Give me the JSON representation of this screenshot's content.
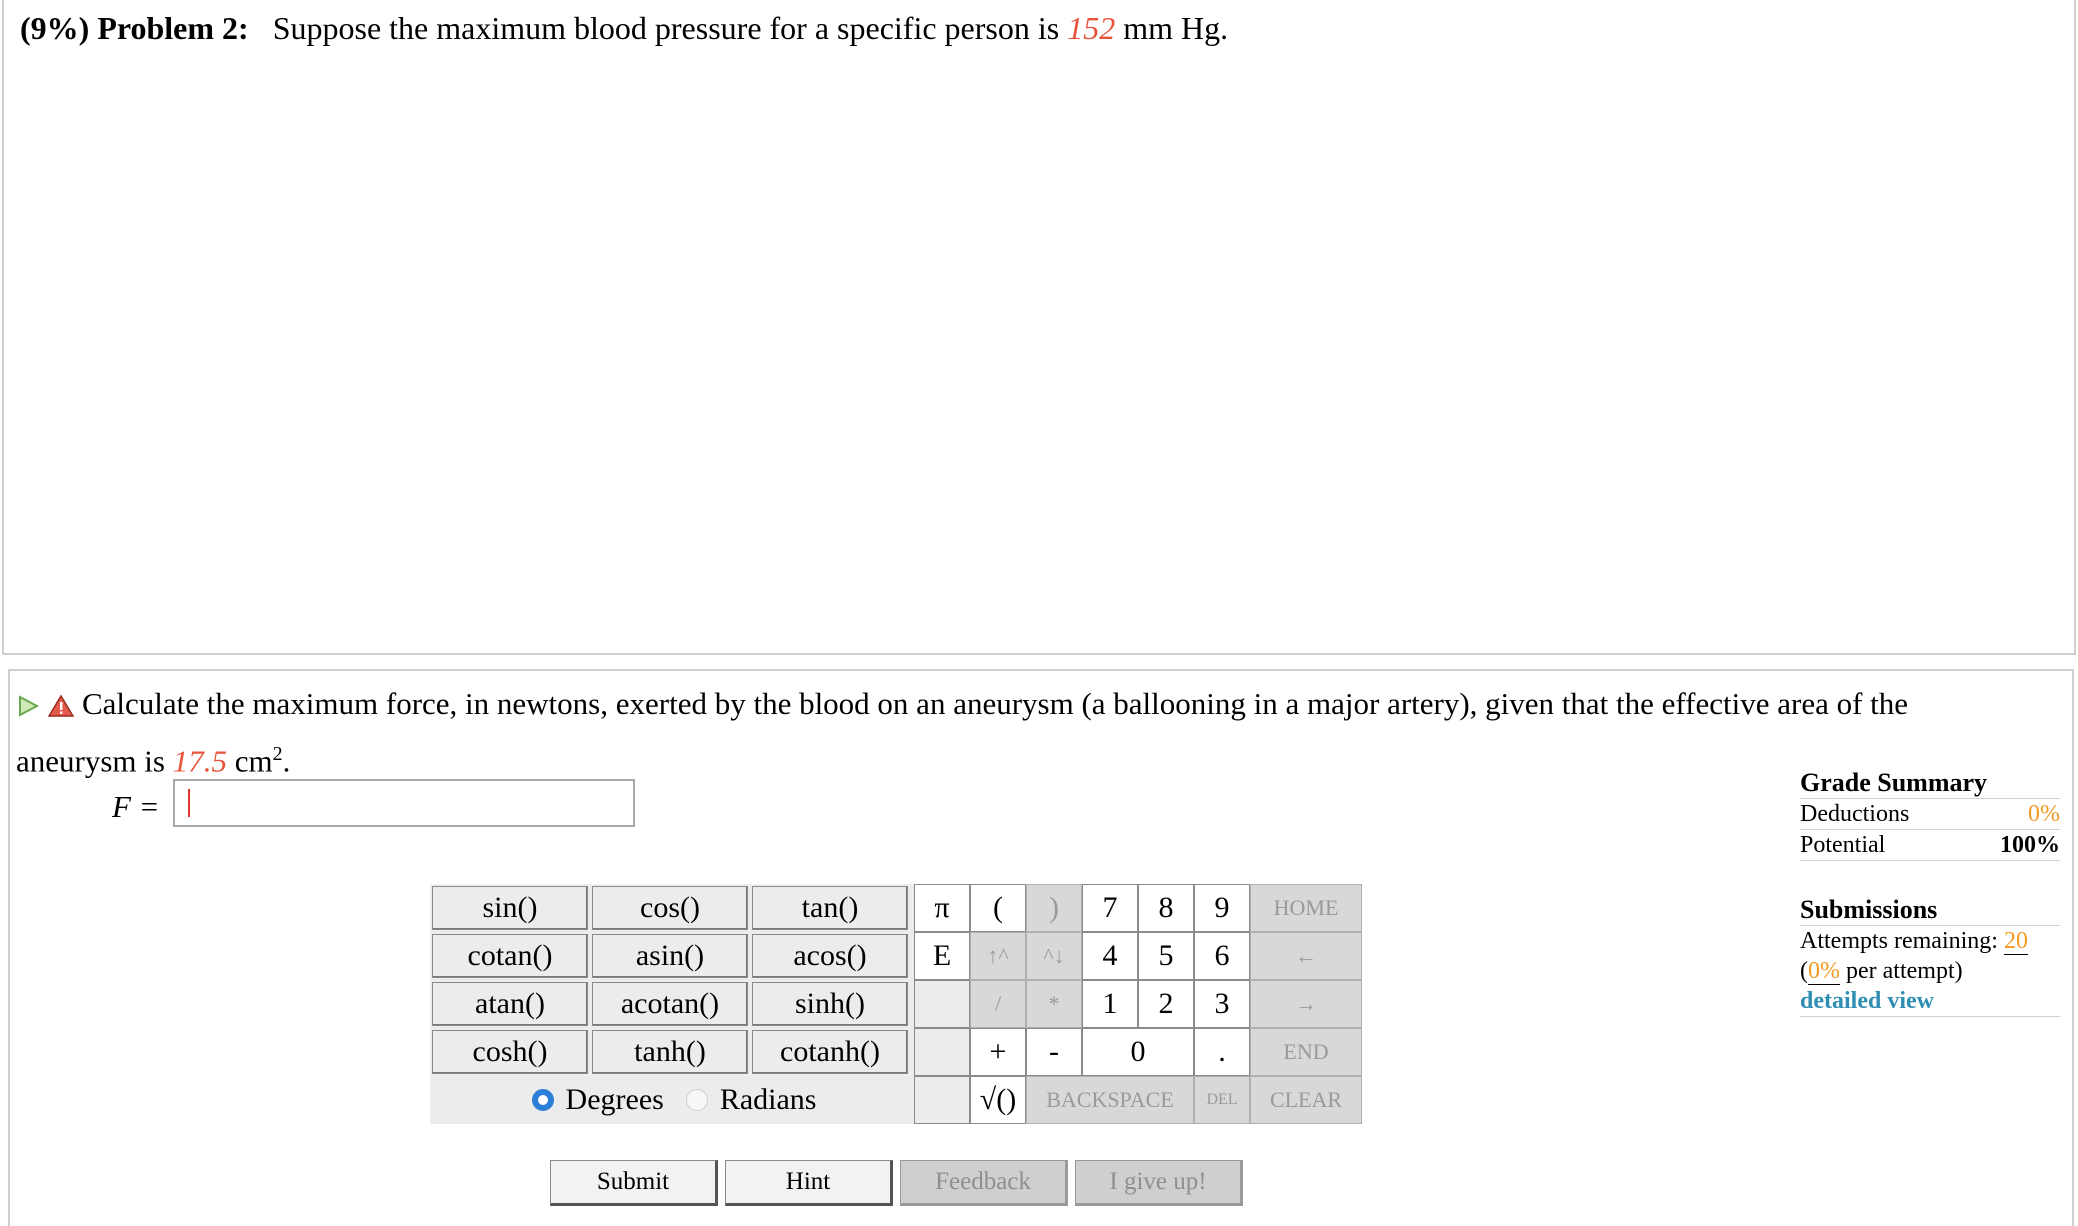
{
  "problem": {
    "percent": "(9%)",
    "name": "Problem 2:",
    "text_before": "Suppose the maximum blood pressure for a specific person is",
    "value": "152",
    "unit": "mm Hg."
  },
  "part": {
    "text_before": "Calculate the maximum force, in newtons, exerted by the blood on an aneurysm (a ballooning in a major artery), given that the effective area of the aneurysm is",
    "value": "17.5",
    "unit": "cm",
    "unit_exp": "2",
    "unit_after": ".",
    "answer_label": "F =",
    "answer_value": ""
  },
  "keypad": {
    "functions": [
      "sin()",
      "cos()",
      "tan()",
      "cotan()",
      "asin()",
      "acos()",
      "atan()",
      "acotan()",
      "sinh()",
      "cosh()",
      "tanh()",
      "cotanh()"
    ],
    "degrees": "Degrees",
    "radians": "Radians",
    "pi": "π",
    "open_paren": "(",
    "close_paren": ")",
    "e": "E",
    "up_caret": "↑^",
    "down_caret": "^↓",
    "slash": "/",
    "star": "*",
    "plus": "+",
    "minus": "-",
    "sqrt": "√()",
    "digits": [
      "7",
      "8",
      "9",
      "4",
      "5",
      "6",
      "1",
      "2",
      "3",
      "0",
      "."
    ],
    "home": "HOME",
    "left": "←",
    "right": "→",
    "end": "END",
    "backspace": "BACKSPACE",
    "del": "DEL",
    "clear": "CLEAR"
  },
  "buttons": {
    "submit": "Submit",
    "hint": "Hint",
    "feedback": "Feedback",
    "give_up": "I give up!"
  },
  "grade_summary": {
    "title": "Grade Summary",
    "deductions_label": "Deductions",
    "deductions_value": "0%",
    "potential_label": "Potential",
    "potential_value": "100%",
    "submissions_title": "Submissions",
    "attempts_label": "Attempts remaining:",
    "attempts_value": "20",
    "per_attempt_open": "(",
    "per_attempt_value": "0%",
    "per_attempt_label": "per attempt)",
    "detailed_view": "detailed view"
  },
  "colors": {
    "accent_value": "#e8543a",
    "orange": "#f09a22",
    "link": "#2f8fb3",
    "radio": "#2b7fd8"
  }
}
